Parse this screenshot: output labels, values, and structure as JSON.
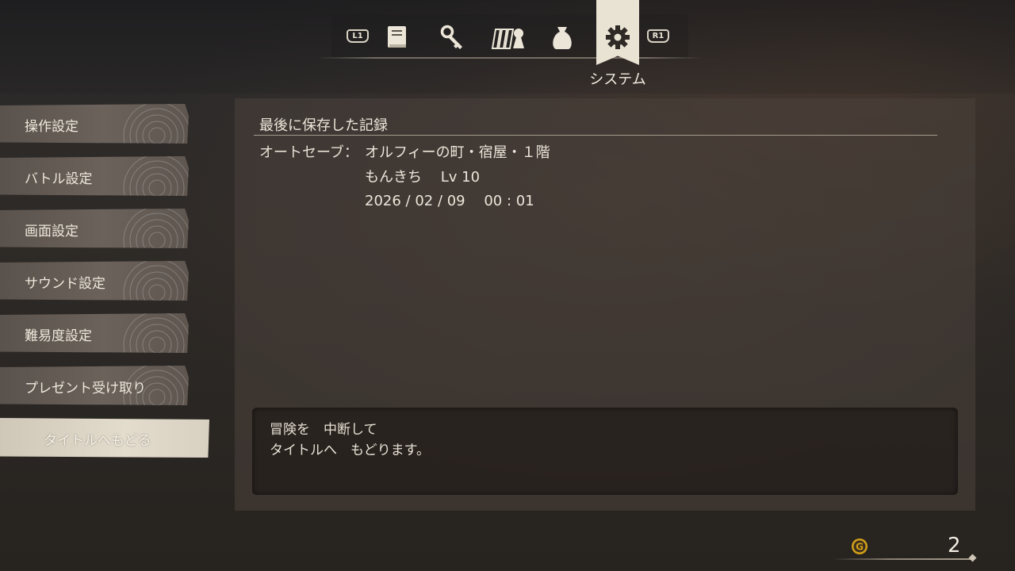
{
  "tabs": {
    "left_hint": "L1",
    "right_hint": "R1",
    "icons": [
      "book-icon",
      "key-icon",
      "party-icon",
      "bag-icon",
      "gear-icon"
    ],
    "active_label": "システム"
  },
  "sidebar": {
    "items": [
      {
        "label": "操作設定"
      },
      {
        "label": "バトル設定"
      },
      {
        "label": "画面設定"
      },
      {
        "label": "サウンド設定"
      },
      {
        "label": "難易度設定"
      },
      {
        "label": "プレゼント受け取り"
      },
      {
        "label": "タイトルへもどる"
      }
    ]
  },
  "save": {
    "title": "最後に保存した記録",
    "label": "オートセーブ：",
    "location": "オルフィーの町・宿屋・１階",
    "character": "もんきち　 Lv 10",
    "datetime": "2026 / 02 / 09　 00 : 01"
  },
  "message": {
    "line1": "冒険を　中断して",
    "line2": "タイトルへ　もどります。"
  },
  "gold": {
    "amount": "2"
  },
  "colors": {
    "accent": "#e9e3d3",
    "gold": "#d4a018"
  }
}
